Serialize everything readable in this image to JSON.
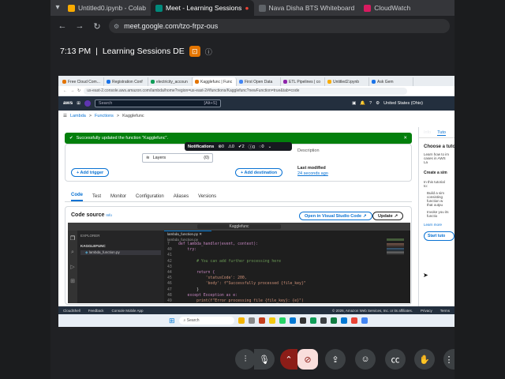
{
  "browser": {
    "tabs": [
      {
        "label": "Untitled0.ipynb - Colab",
        "color": "#f9ab00",
        "active": false
      },
      {
        "label": "Meet - Learning Sessions",
        "color": "#00897b",
        "active": true
      },
      {
        "label": "Nava Disha BTS Whiteboard",
        "color": "#5f6368",
        "active": false
      },
      {
        "label": "CloudWatch",
        "color": "#d81b60",
        "active": false
      }
    ],
    "url": "meet.google.com/tzo-frpz-ous"
  },
  "meet": {
    "time": "7:13 PM",
    "separator": "|",
    "title": "Learning Sessions DE"
  },
  "shared": {
    "tabs": [
      "Free Cloud Com...",
      "Registration Conf",
      "electricity_accoun",
      "Kagglefunc | Func",
      "First Open Data",
      "ETL Pipelines | co",
      "Untitled2.ipynb",
      "Ask Gem"
    ],
    "url": "us-east-2.console.aws.amazon.com/lambda/home?region=us-east-2#/functions/Kagglefunc?newFunction=true&tab=code",
    "aws": {
      "logo": "aws",
      "search": "Search",
      "shortcut": "[Alt+S]",
      "region": "United States (Ohio)"
    },
    "breadcrumb": [
      "Lambda",
      ">",
      "Functions",
      ">",
      "Kagglefunc"
    ],
    "flash": "Successfully updated the function \"Kagglefunc\".",
    "notifications": {
      "label": "Notifications",
      "counts": [
        "0",
        "0",
        "2",
        "0",
        "0"
      ]
    },
    "function": {
      "layers": "Layers",
      "layers_count": "(0)",
      "add_trigger": "+ Add trigger",
      "add_destination": "+ Add destination",
      "last_modified_label": "Last modified",
      "last_modified_value": "24 seconds ago",
      "description": "Description"
    },
    "tabs_lambda": [
      "Code",
      "Test",
      "Monitor",
      "Configuration",
      "Aliases",
      "Versions"
    ],
    "code_source": {
      "title": "Code source",
      "info": "Info",
      "open_vscode": "Open in Visual Studio Code",
      "update": "Update",
      "editor_title": "Kagglefunc",
      "explorer": "EXPLORER",
      "folder": "KAGGLEFUNC",
      "file": "lambda_function.py",
      "tab_file": "lambda_function.py",
      "crumb_file": "lambda_function.py",
      "lines": [
        {
          "n": "7",
          "t": "def lambda_handler(event, context):"
        },
        {
          "n": "40",
          "t": "    try:"
        },
        {
          "n": "41",
          "t": ""
        },
        {
          "n": "42",
          "t": "        # You can add further processing here"
        },
        {
          "n": "43",
          "t": ""
        },
        {
          "n": "44",
          "t": "        return {"
        },
        {
          "n": "45",
          "t": "            'statusCode': 200,"
        },
        {
          "n": "46",
          "t": "            'body': f\"Successfully processed {file_key}\""
        },
        {
          "n": "47",
          "t": "        }"
        },
        {
          "n": "48",
          "t": "    except Exception as e:"
        },
        {
          "n": "49",
          "t": "        print(f\"Error processing file {file_key}: {e}\")"
        }
      ]
    },
    "sidepanel": {
      "tab_info": "Info",
      "tab_tut": "Tuto",
      "heading": "Choose a tuto",
      "p1": "Learn how to im cases in AWS La",
      "h2": "Create a sim",
      "p2": "In this tutorial to:",
      "b1": "Build a sim consisting function w that outpu",
      "b2": "Invoke you its functio",
      "learn": "Learn more",
      "start": "Start tuto"
    },
    "footer": {
      "cloudshell": "CloudShell",
      "feedback": "Feedback",
      "console_app": "Console Mobile App",
      "copyright": "© 2026, Amazon Web Services, Inc. or its affiliates.",
      "privacy": "Privacy",
      "terms": "Terms"
    },
    "taskbar": {
      "search": "Search"
    }
  },
  "controls": [
    "mic-level",
    "mic",
    "more",
    "camera-off",
    "present",
    "emoji",
    "captions",
    "raise-hand",
    "more-options"
  ]
}
